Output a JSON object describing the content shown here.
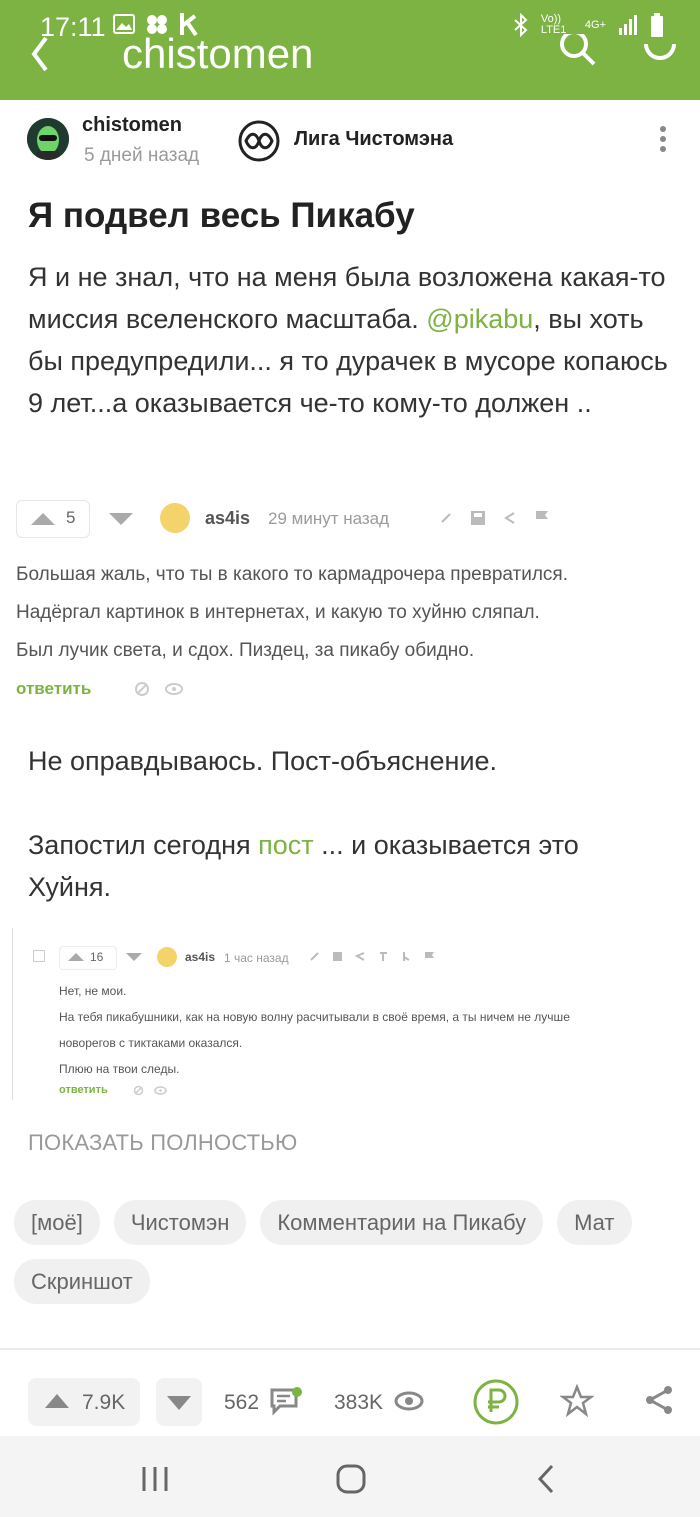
{
  "status_bar": {
    "time": "17:11",
    "network": "Vo)) LTE1",
    "network_type": "4G+"
  },
  "app_bar": {
    "title": "chistomen"
  },
  "post": {
    "author": "chistomen",
    "time_ago": "5 дней назад",
    "community": "Лига Чистомэна",
    "title": "Я подвел весь Пикабу",
    "text_before_link": "Я и не знал, что на меня была возложена какая-то миссия вселенского масштаба. ",
    "mention": "@pikabu",
    "text_after_link": ", вы хоть бы предупредили... я то дурачек в мусоре копаюсь 9 лет...а оказывается че-то кому-то должен ..",
    "paragraph2": "Не оправдываюсь. Пост-объяснение.",
    "paragraph3_before": "Запостил сегодня ",
    "paragraph3_link": "пост",
    "paragraph3_after": " ... и оказывается это Хуйня.",
    "show_full_label": "ПОКАЗАТЬ ПОЛНОСТЬЮ"
  },
  "comment1": {
    "score": "5",
    "author": "as4is",
    "time": "29 минут назад",
    "lines": [
      "Большая жаль, что ты в какого то кармадрочера превратился.",
      "Надёргал картинок в интернетах, и какую то хуйню сляпал.",
      "Был лучик света, и сдох. Пиздец, за пикабу обидно."
    ],
    "reply_label": "ответить"
  },
  "comment2": {
    "score": "16",
    "author": "as4is",
    "time": "1 час назад",
    "lines": [
      "Нет, не мои.",
      "На тебя пикабушники, как на новую волну расчитывали в своё время, а ты ничем не лучше",
      "новорегов с тиктаками оказался.",
      "Плюю на твои следы."
    ],
    "reply_label": "ответить"
  },
  "tags": [
    "[моё]",
    "Чистомэн",
    "Комментарии на Пикабу",
    "Мат",
    "Скриншот"
  ],
  "actions": {
    "rating": "7.9K",
    "comments": "562",
    "views": "383K"
  },
  "colors": {
    "accent": "#7cb342",
    "muted": "#9a9a9a"
  }
}
